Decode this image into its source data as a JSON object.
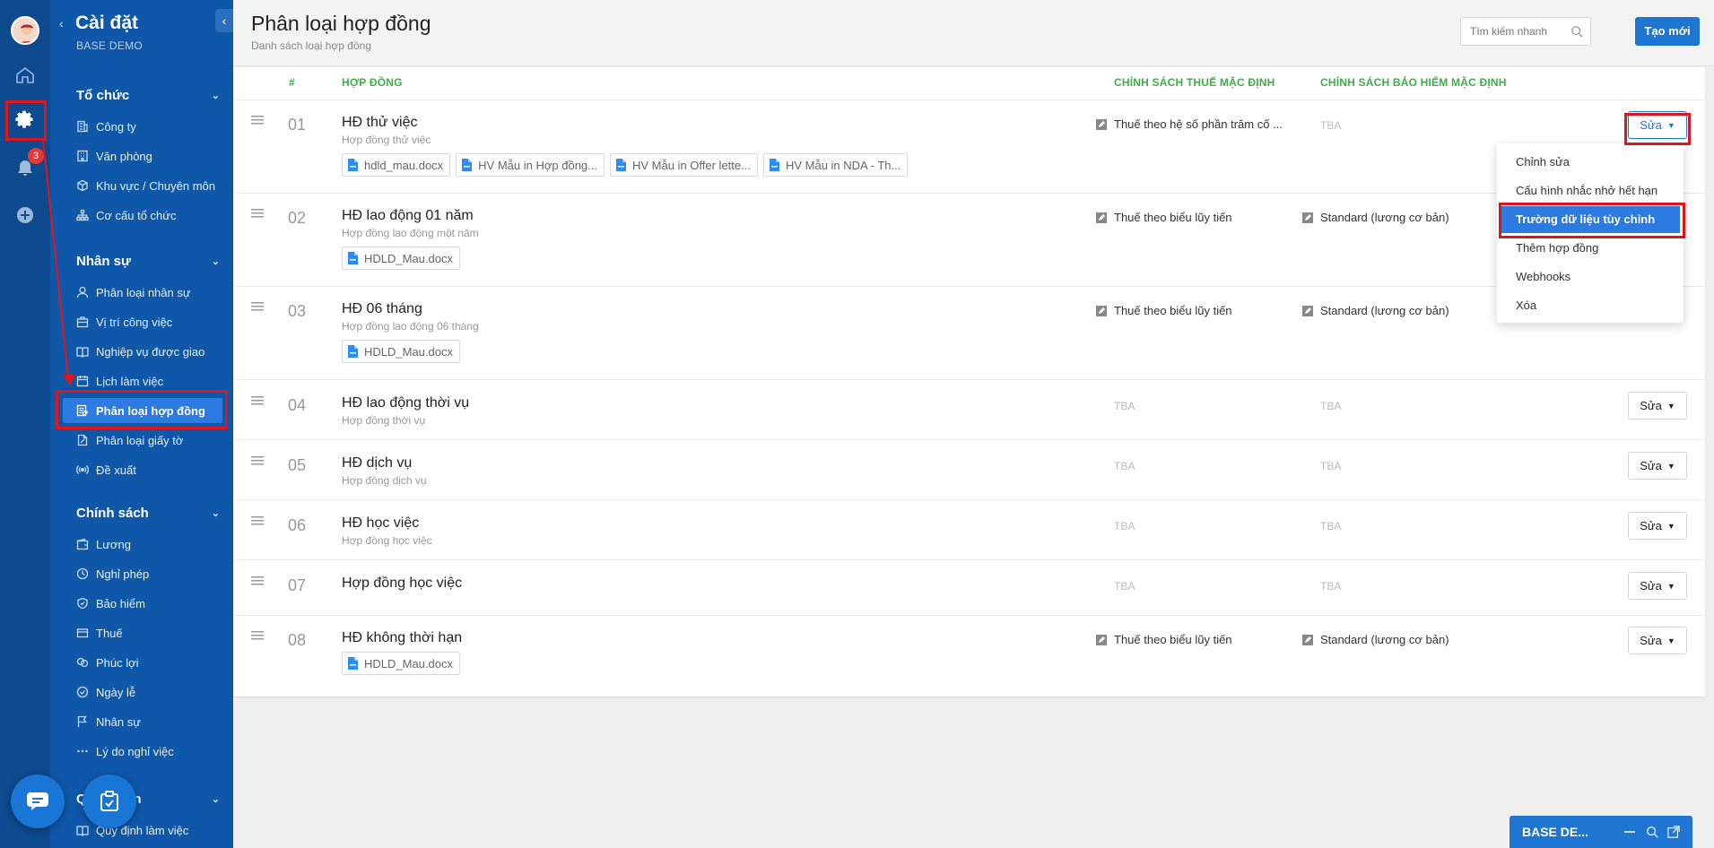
{
  "app": {
    "title": "Cài đặt",
    "workspace": "BASE DEMO"
  },
  "rail": {
    "notification_count": "3"
  },
  "sidebar": {
    "sections": [
      {
        "title": "Tổ chức",
        "items": [
          {
            "label": "Công ty",
            "icon": "building-icon"
          },
          {
            "label": "Văn phòng",
            "icon": "office-icon"
          },
          {
            "label": "Khu vực / Chuyên môn",
            "icon": "cube-icon"
          },
          {
            "label": "Cơ cấu tổ chức",
            "icon": "org-chart-icon"
          }
        ]
      },
      {
        "title": "Nhân sự",
        "items": [
          {
            "label": "Phân loại nhân sự",
            "icon": "user-icon"
          },
          {
            "label": "Vị trí công việc",
            "icon": "briefcase-icon"
          },
          {
            "label": "Nghiệp vụ được giao",
            "icon": "book-icon"
          },
          {
            "label": "Lịch làm việc",
            "icon": "calendar-icon"
          },
          {
            "label": "Phân loại hợp đồng",
            "icon": "contract-icon",
            "active": true
          },
          {
            "label": "Phân loại giấy tờ",
            "icon": "document-icon"
          },
          {
            "label": "Đề xuất",
            "icon": "broadcast-icon"
          }
        ]
      },
      {
        "title": "Chính sách",
        "items": [
          {
            "label": "Lương",
            "icon": "wallet-icon"
          },
          {
            "label": "Nghỉ phép",
            "icon": "clock-icon"
          },
          {
            "label": "Bảo hiểm",
            "icon": "shield-icon"
          },
          {
            "label": "Thuế",
            "icon": "card-icon"
          },
          {
            "label": "Phúc lợi",
            "icon": "gift-icon"
          },
          {
            "label": "Ngày lễ",
            "icon": "check-circle-icon"
          },
          {
            "label": "Nhân sự",
            "icon": "flag-icon"
          },
          {
            "label": "Lý do nghỉ việc",
            "icon": "dots-icon"
          }
        ]
      },
      {
        "title": "Q văn bản",
        "items": [
          {
            "label": "Quy định làm việc",
            "icon": "book-icon"
          }
        ]
      }
    ]
  },
  "header": {
    "title": "Phân loại hợp đồng",
    "subtitle": "Danh sách loại hợp đồng",
    "search_placeholder": "Tìm kiếm nhanh",
    "create_label": "Tạo mới"
  },
  "table": {
    "columns": {
      "index": "#",
      "contract": "HỢP ĐỒNG",
      "tax": "CHÍNH SÁCH THUẾ MẶC ĐỊNH",
      "insurance": "CHÍNH SÁCH BẢO HIỂM MẶC ĐỊNH"
    },
    "edit_label": "Sửa",
    "rows": [
      {
        "num": "01",
        "name": "HĐ thử việc",
        "desc": "Hợp đồng thử việc",
        "files": [
          "hdld_mau.docx",
          "HV Mẫu in Hợp đồng...",
          "HV Mẫu in Offer lette...",
          "HV Mẫu in NDA - Th..."
        ],
        "tax": "Thuế theo hệ số phần trăm cố ...",
        "insurance": "TBA",
        "menu_open": true
      },
      {
        "num": "02",
        "name": "HĐ lao động 01 năm",
        "desc": "Hợp đồng lao động một năm",
        "files": [
          "HDLD_Mau.docx"
        ],
        "tax": "Thuế theo biểu lũy tiến",
        "insurance": "Standard (lương cơ bản)"
      },
      {
        "num": "03",
        "name": "HĐ 06 tháng",
        "desc": "Hợp đồng lao động 06 tháng",
        "files": [
          "HDLD_Mau.docx"
        ],
        "tax": "Thuế theo biểu lũy tiến",
        "insurance": "Standard (lương cơ bản)"
      },
      {
        "num": "04",
        "name": "HĐ lao động thời vụ",
        "desc": "Hợp đồng thời vụ",
        "files": [],
        "tax": "TBA",
        "insurance": "TBA"
      },
      {
        "num": "05",
        "name": "HĐ dịch vụ",
        "desc": "Hợp đồng dịch vụ",
        "files": [],
        "tax": "TBA",
        "insurance": "TBA"
      },
      {
        "num": "06",
        "name": "HĐ học việc",
        "desc": "Hợp đồng học việc",
        "files": [],
        "tax": "TBA",
        "insurance": "TBA"
      },
      {
        "num": "07",
        "name": "Hợp đồng học việc",
        "desc": "",
        "files": [],
        "tax": "TBA",
        "insurance": "TBA"
      },
      {
        "num": "08",
        "name": "HĐ không thời hạn",
        "desc": "",
        "files": [
          "HDLD_Mau.docx"
        ],
        "tax": "Thuế theo biểu lũy tiến",
        "insurance": "Standard (lương cơ bản)"
      }
    ]
  },
  "dropdown": {
    "items": [
      "Chỉnh sửa",
      "Cấu hình nhắc nhở hết hạn",
      "Trường dữ liệu tùy chỉnh",
      "Thêm hợp đồng",
      "Webhooks",
      "Xóa"
    ],
    "highlighted": "Trường dữ liệu tùy chỉnh"
  },
  "chat_widget": {
    "title": "BASE DE..."
  },
  "colors": {
    "sidebar": "#0f57a8",
    "rail": "#0d4a8f",
    "accent": "#1e76d2",
    "header_green": "#3fae49",
    "annotation_red": "#e0141b"
  }
}
